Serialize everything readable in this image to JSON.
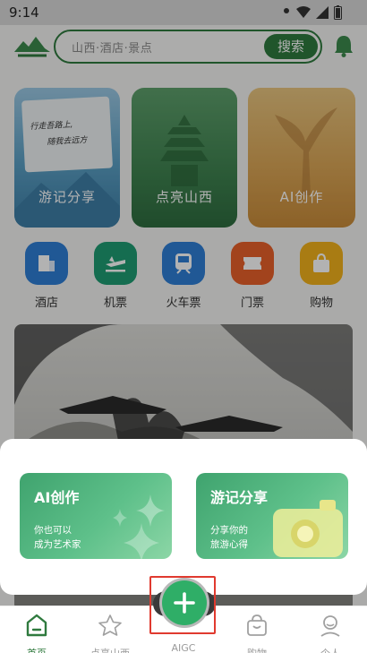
{
  "status_bar": {
    "time": "9:14"
  },
  "header": {
    "search_placeholder": "山西·酒店·景点",
    "search_button": "搜索"
  },
  "feature_cards": [
    {
      "label": "游记分享",
      "paper_line1": "行走吾路上,",
      "paper_line2": "随我去远方"
    },
    {
      "label": "点亮山西"
    },
    {
      "label": "AI创作"
    }
  ],
  "quick_icons": [
    {
      "label": "酒店",
      "color": "#2f7fd6"
    },
    {
      "label": "机票",
      "color": "#1f9c73"
    },
    {
      "label": "火车票",
      "color": "#2f7fd6"
    },
    {
      "label": "门票",
      "color": "#e8602a"
    },
    {
      "label": "购物",
      "color": "#f2b21c"
    }
  ],
  "popup": {
    "ai_card": {
      "title": "AI创作",
      "subtitle_line1": "你也可以",
      "subtitle_line2": "成为艺术家"
    },
    "travel_card": {
      "title": "游记分享",
      "subtitle_line1": "分享你的",
      "subtitle_line2": "旅游心得"
    }
  },
  "tabbar": {
    "items": [
      {
        "label": "首页",
        "active": true
      },
      {
        "label": "点亮山西",
        "active": false
      },
      {
        "label": "AIGC",
        "active": false
      },
      {
        "label": "购物",
        "active": false
      },
      {
        "label": "个人",
        "active": false
      }
    ]
  },
  "colors": {
    "brand_green": "#2f7a3e",
    "fab_green": "#2fae67",
    "highlight_red": "#e03a2f"
  }
}
